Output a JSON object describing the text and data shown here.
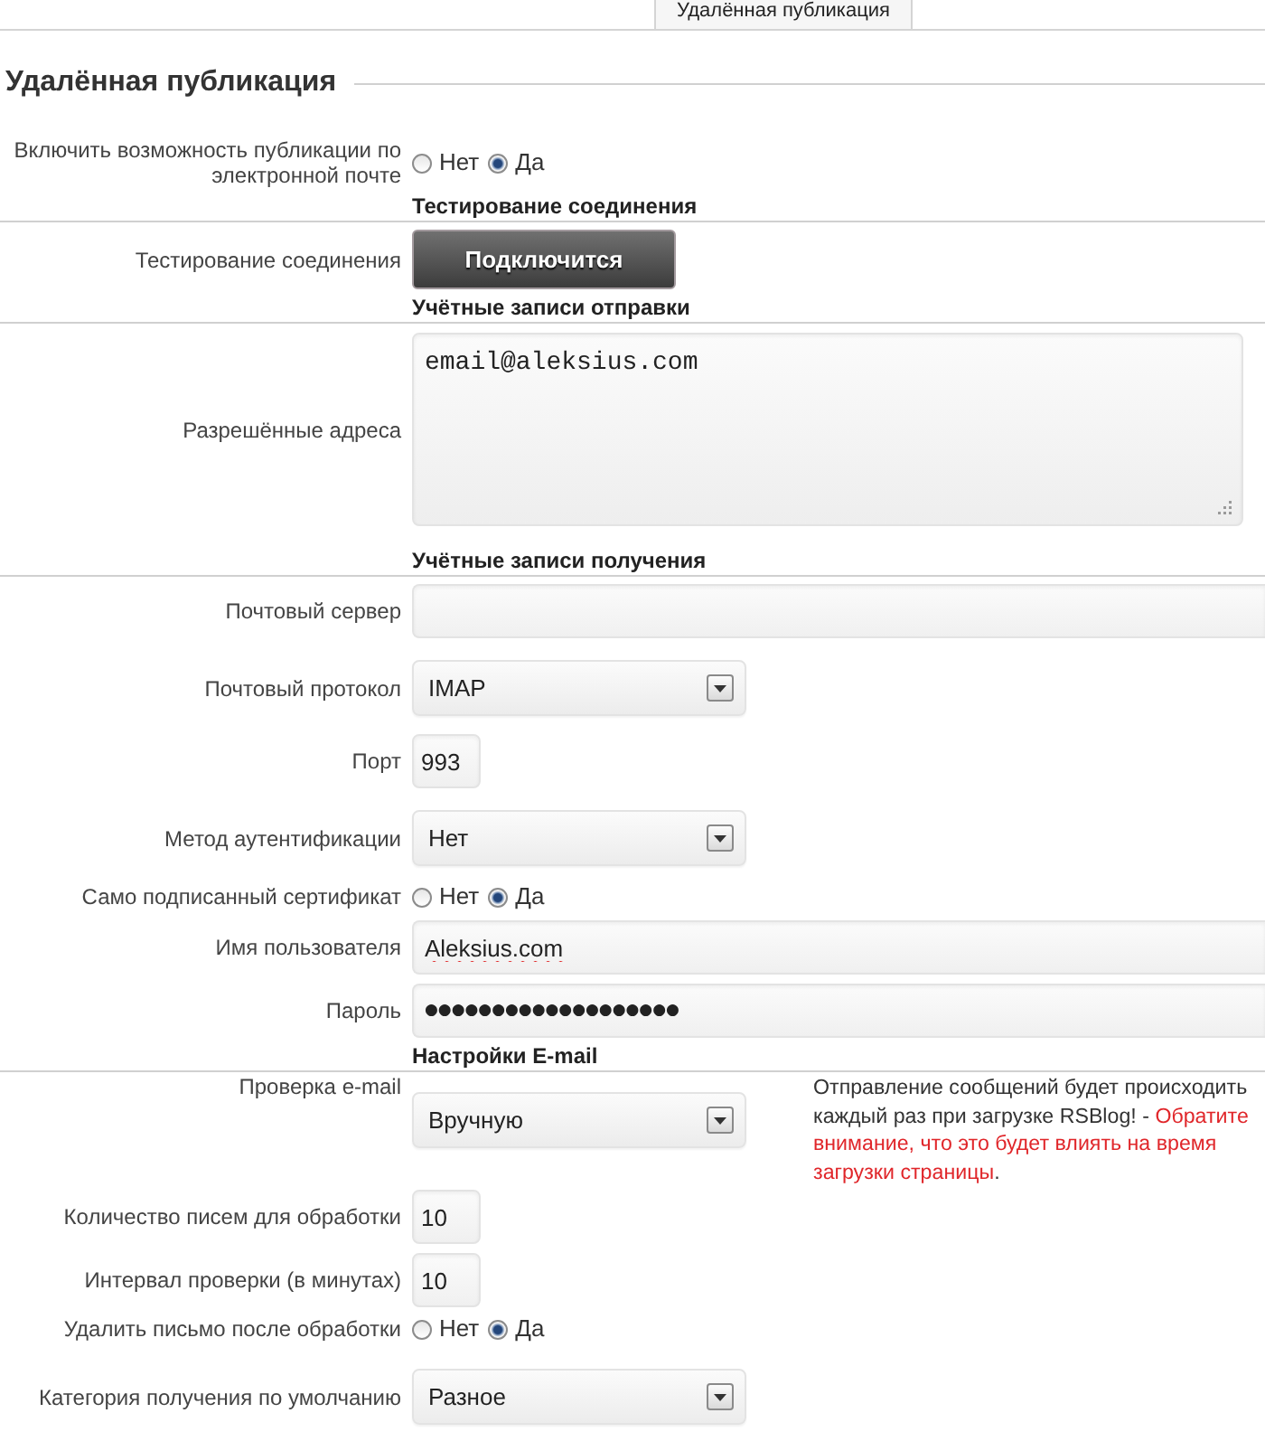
{
  "tabs": [
    {
      "label": "Удалённая публикация",
      "selected": true
    }
  ],
  "title": "Удалённая публикация",
  "fields": [
    {
      "kind": "radio",
      "label": "Включить возможность публикации по электронной почте",
      "options": [
        {
          "label": "Нет",
          "selected": false
        },
        {
          "label": "Да",
          "selected": true
        }
      ]
    },
    {
      "kind": "section",
      "title": "Тестирование соединения"
    },
    {
      "kind": "button",
      "label": "Тестирование соединения",
      "button": "Подключится"
    },
    {
      "kind": "section",
      "title": "Учётные записи отправки"
    },
    {
      "kind": "textarea",
      "label": "Разрешённые адреса",
      "value": "email@aleksius.com"
    },
    {
      "kind": "section",
      "title": "Учётные записи получения"
    },
    {
      "kind": "text",
      "label": "Почтовый сервер"
    },
    {
      "kind": "select",
      "label": "Почтовый протокол",
      "value": "IMAP"
    },
    {
      "kind": "number",
      "label": "Порт",
      "value": "993"
    },
    {
      "kind": "select",
      "label": "Метод аутентификации",
      "value": "Нет"
    },
    {
      "kind": "radio",
      "label": "Само подписанный сертификат",
      "options": [
        {
          "label": "Нет",
          "selected": false
        },
        {
          "label": "Да",
          "selected": true
        }
      ]
    },
    {
      "kind": "text",
      "label": "Имя пользователя",
      "value": "Aleksius.com",
      "misspelled": true
    },
    {
      "kind": "password",
      "label": "Пароль",
      "value": "●●●●●●●●●●●●●●●●●●●"
    },
    {
      "kind": "section",
      "title": "Настройки E-mail"
    },
    {
      "kind": "select",
      "label": "Проверка e-mail",
      "value": "Вручную",
      "help": "Отправление сообщений будет происходить каждый раз при загрузке RSBlog! - **Обратите внимание, что это будет влиять на время загрузки страницы**."
    },
    {
      "kind": "number",
      "label": "Количество писем для обработки",
      "value": "10"
    },
    {
      "kind": "number",
      "label": "Интервал проверки (в минутах)",
      "value": "10"
    },
    {
      "kind": "radio",
      "label": "Удалить письмо после обработки",
      "options": [
        {
          "label": "Нет",
          "selected": false
        },
        {
          "label": "Да",
          "selected": true
        }
      ]
    },
    {
      "kind": "select",
      "label": "Категория получения по умолчанию",
      "value": "Разное"
    }
  ]
}
